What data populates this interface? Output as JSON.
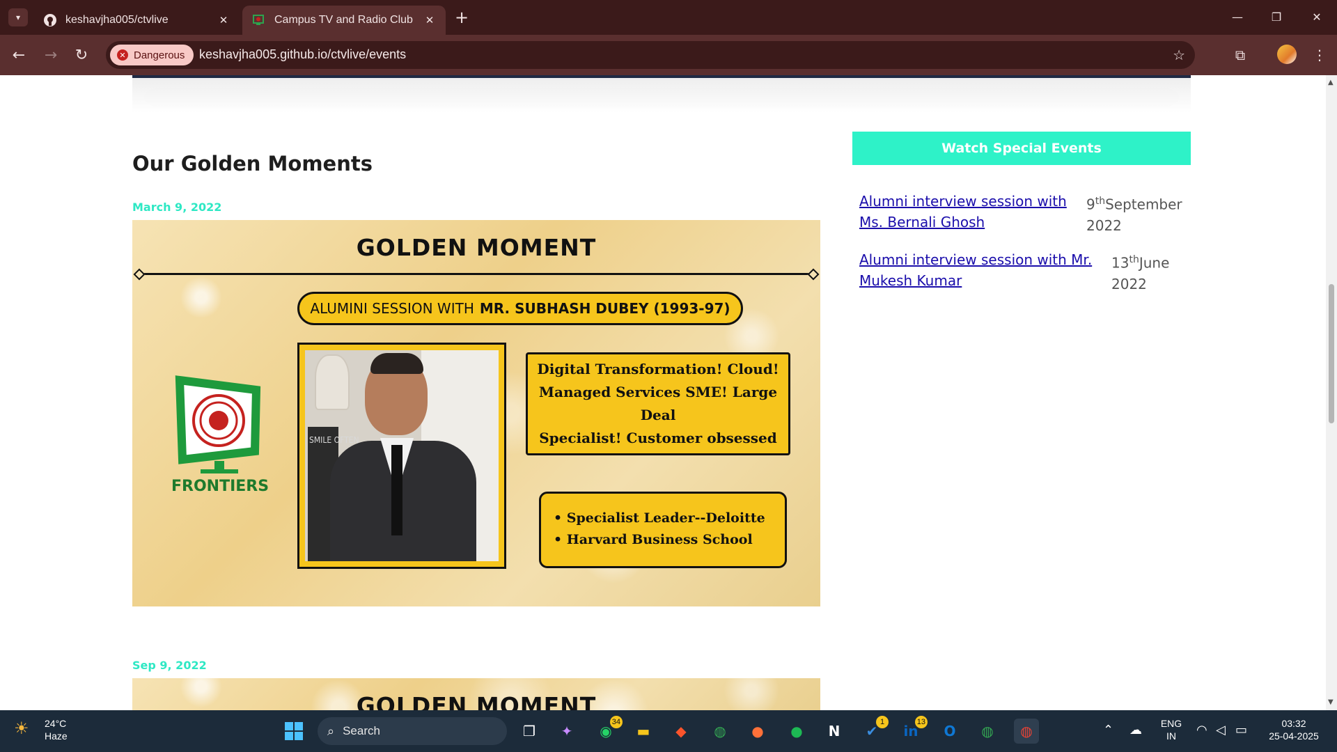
{
  "browser": {
    "tabs": [
      {
        "label": "keshavjha005/ctvlive",
        "icon": "github-icon",
        "active": false
      },
      {
        "label": "Campus TV and Radio Club",
        "icon": "site-favicon-icon",
        "active": true
      }
    ],
    "security_chip": "Dangerous",
    "url": "keshavjha005.github.io/ctvlive/events"
  },
  "page": {
    "section_title": "Our Golden Moments",
    "events": [
      {
        "date": "March 9, 2022",
        "poster": {
          "title": "GOLDEN MOMENT",
          "pill_prefix": "ALUMINI SESSION WITH",
          "pill_name": "MR. SUBHASH DUBEY (1993-97)",
          "logo_text": "FRONTIERS",
          "photo_sign": "SMILE OFTEN",
          "box1_lines": [
            "Digital Transformation! Cloud!",
            "Managed Services SME! Large Deal",
            "Specialist! Customer obsessed"
          ],
          "box2_items": [
            "Specialist Leader--Deloitte",
            "Harvard Business School"
          ]
        }
      },
      {
        "date": "Sep 9, 2022",
        "poster": {
          "title": "GOLDEN MOMENT"
        }
      }
    ],
    "sidebar": {
      "heading": "Watch Special Events",
      "items": [
        {
          "link_line1": "Alumni interview session with",
          "link_line2": "Ms. Bernali Ghosh",
          "day": "9",
          "suffix": "th",
          "month": "September",
          "year": "2022"
        },
        {
          "link_line1": "Alumni interview session with Mr.",
          "link_line2": "Mukesh Kumar",
          "day": "13",
          "suffix": "th",
          "month": "June",
          "year": "2022"
        }
      ]
    }
  },
  "taskbar": {
    "weather_temp": "24°C",
    "weather_desc": "Haze",
    "search_label": "Search",
    "badges": {
      "whatsapp": "34",
      "todo": "1",
      "linkedin": "13"
    },
    "lang_line1": "ENG",
    "lang_line2": "IN",
    "time": "03:32",
    "date": "25-04-2025"
  },
  "colors": {
    "accent_teal": "#2ef2c8",
    "poster_yellow": "#f6c51c",
    "chrome_dark": "#3b1a1a",
    "link_blue": "#1a0dab"
  }
}
